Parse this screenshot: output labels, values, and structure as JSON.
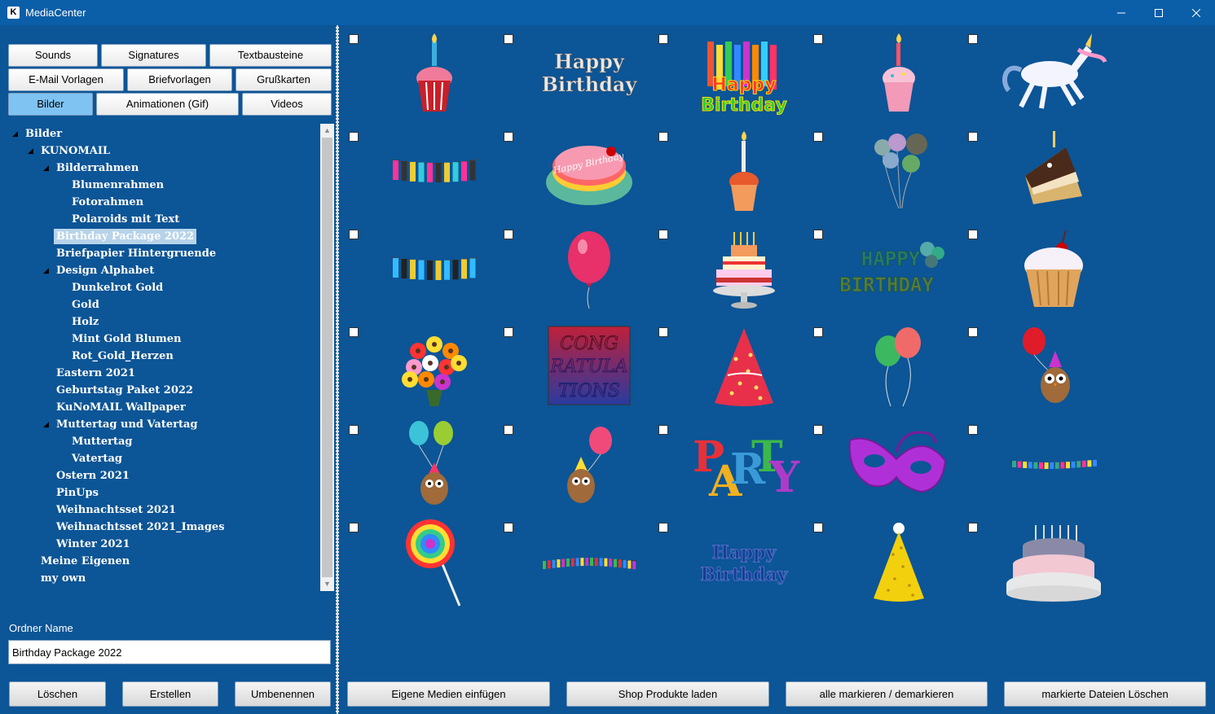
{
  "window": {
    "title": "MediaCenter",
    "app_icon": "K"
  },
  "tabs": [
    {
      "label": "Sounds",
      "active": false
    },
    {
      "label": "Signatures",
      "active": false
    },
    {
      "label": "Textbausteine",
      "active": false
    },
    {
      "label": "E-Mail Vorlagen",
      "active": false
    },
    {
      "label": "Briefvorlagen",
      "active": false
    },
    {
      "label": "Grußkarten",
      "active": false
    },
    {
      "label": "Bilder",
      "active": true
    },
    {
      "label": "Animationen (Gif)",
      "active": false
    },
    {
      "label": "Videos",
      "active": false
    }
  ],
  "tree": [
    {
      "label": "Bilder",
      "level": 0,
      "expanded": true
    },
    {
      "label": "KUNOMAIL",
      "level": 1,
      "expanded": true
    },
    {
      "label": "Bilderrahmen",
      "level": 2,
      "expanded": true
    },
    {
      "label": "Blumenrahmen",
      "level": 3
    },
    {
      "label": "Fotorahmen",
      "level": 3
    },
    {
      "label": "Polaroids mit Text",
      "level": 3
    },
    {
      "label": "Birthday Package 2022",
      "level": 2,
      "selected": true
    },
    {
      "label": "Briefpapier Hintergruende",
      "level": 2
    },
    {
      "label": "Design Alphabet",
      "level": 2,
      "expanded": true
    },
    {
      "label": "Dunkelrot Gold",
      "level": 3
    },
    {
      "label": "Gold",
      "level": 3
    },
    {
      "label": "Holz",
      "level": 3
    },
    {
      "label": "Mint Gold Blumen",
      "level": 3
    },
    {
      "label": "Rot_Gold_Herzen",
      "level": 3
    },
    {
      "label": "Eastern 2021",
      "level": 2
    },
    {
      "label": "Geburtstag Paket 2022",
      "level": 2
    },
    {
      "label": "KuNoMAIL Wallpaper",
      "level": 2
    },
    {
      "label": "Muttertag und Vatertag",
      "level": 2,
      "expanded": true
    },
    {
      "label": "Muttertag",
      "level": 3
    },
    {
      "label": "Vatertag",
      "level": 3
    },
    {
      "label": "Ostern 2021",
      "level": 2
    },
    {
      "label": "PinUps",
      "level": 2
    },
    {
      "label": "Weihnachtsset 2021",
      "level": 2
    },
    {
      "label": "Weihnachtsset 2021_Images",
      "level": 2
    },
    {
      "label": "Winter 2021",
      "level": 2
    },
    {
      "label": "Meine Eigenen",
      "level": 1
    },
    {
      "label": "my own",
      "level": 1
    }
  ],
  "folder": {
    "label": "Ordner Name",
    "value": "Birthday Package 2022"
  },
  "left_buttons": {
    "delete": "Löschen",
    "create": "Erstellen",
    "rename": "Umbenennen"
  },
  "right_buttons": {
    "insert": "Eigene Medien einfügen",
    "shop": "Shop Produkte laden",
    "toggle_all": "alle markieren / demarkieren",
    "delete_marked": "markierte Dateien Löschen"
  },
  "thumb_texts": {
    "happy": "Happy",
    "birthday": "Birthday",
    "happy_caps": "HAPPY",
    "birthday_caps": "BIRTHDAY",
    "congrats_1": "CONG",
    "congrats_2": "RAT",
    "congrats_3": "ULA",
    "congrats_4": "TIONS",
    "party": "PARTY"
  },
  "images": [
    "cupcake-candle-icon",
    "happy-birthday-text-icon",
    "birthday-candles-cake-icon",
    "pink-cupcake-icon",
    "unicorn-icon",
    "garland-pink-icon",
    "birthday-cake-top-icon",
    "cupcake-candle-2-icon",
    "balloons-bunch-icon",
    "cake-slice-icon",
    "garland-blue-icon",
    "pink-balloon-icon",
    "layered-cake-icon",
    "happy-birthday-balloons-icon",
    "muffin-cherry-icon",
    "flower-bouquet-icon",
    "congratulations-icon",
    "party-hat-red-icon",
    "balloons-pair-icon",
    "owl-balloon-icon",
    "owl-two-balloons-icon",
    "owl-pink-balloon-icon",
    "party-text-icon",
    "party-mask-icon",
    "banner-small-icon",
    "lollipop-icon",
    "streamer-icon",
    "happy-birthday-blue-text-icon",
    "party-hat-yellow-icon",
    "big-cake-icon"
  ]
}
